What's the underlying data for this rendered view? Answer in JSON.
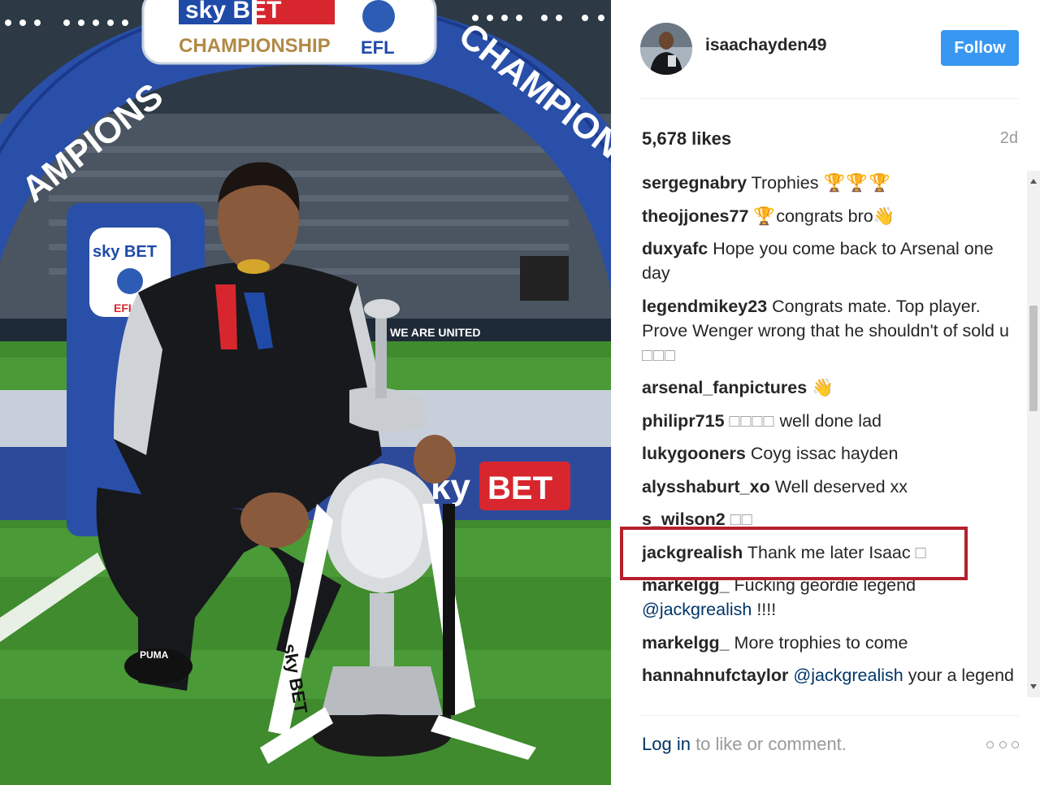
{
  "photo": {
    "banner_top": "sky BET",
    "banner_sub": "CHAMPIONSHIP",
    "banner_efl": "EFL",
    "arch_left": "AMPIONS",
    "arch_right": "CHAMPIONS",
    "pillar_sky": "sky BET",
    "pillar_efl": "EFL",
    "board_text": "WE ARE UNITED",
    "board_bet": "BET",
    "board_sky": "ky",
    "ribbon_text": "sky BET",
    "shoe_text": "PUMA"
  },
  "header": {
    "username": "isaachayden49",
    "follow_label": "Follow"
  },
  "stats": {
    "likes": "5,678 likes",
    "time_ago": "2d"
  },
  "comments": [
    {
      "user": "sergegnabry",
      "text": " Trophies ",
      "emoji": "🏆🏆🏆"
    },
    {
      "user": "theojjones77",
      "text": " ",
      "emoji": "🏆",
      "text2": "congrats bro",
      "emoji2": "👋"
    },
    {
      "user": "duxyafc",
      "text": " Hope you come back to Arsenal one day"
    },
    {
      "user": "legendmikey23",
      "text": " Congrats mate. Top player. Prove Wenger wrong that he shouldn't of sold u ",
      "emoji": "□□□"
    },
    {
      "user": "arsenal_fanpictures",
      "text": " ",
      "emoji": "👋"
    },
    {
      "user": "philipr715",
      "text": " ",
      "emoji": "□□□□",
      "text2": " well done lad"
    },
    {
      "user": "lukygooners",
      "text": " Coyg issac hayden"
    },
    {
      "user": "alysshaburt_xo",
      "text": " Well deserved xx"
    },
    {
      "user": "s_wilson2",
      "text": " ",
      "emoji": "□□"
    },
    {
      "user": "jackgrealish",
      "text": " Thank me later Isaac ",
      "emoji": "□"
    },
    {
      "user": "markelgg_",
      "text": " Fucking geordie legend ",
      "mention": "@jackgrealish",
      "text2": " !!!!"
    },
    {
      "user": "markelgg_",
      "text": " More trophies to come"
    },
    {
      "user": "hannahnufctaylor",
      "text": " ",
      "mention": "@jackgrealish",
      "text2": " your a legend"
    }
  ],
  "footer": {
    "login_link": "Log in",
    "login_rest": " to like or comment."
  },
  "colors": {
    "follow_bg": "#3897f0",
    "highlight": "#b4202c",
    "link": "#003569"
  }
}
